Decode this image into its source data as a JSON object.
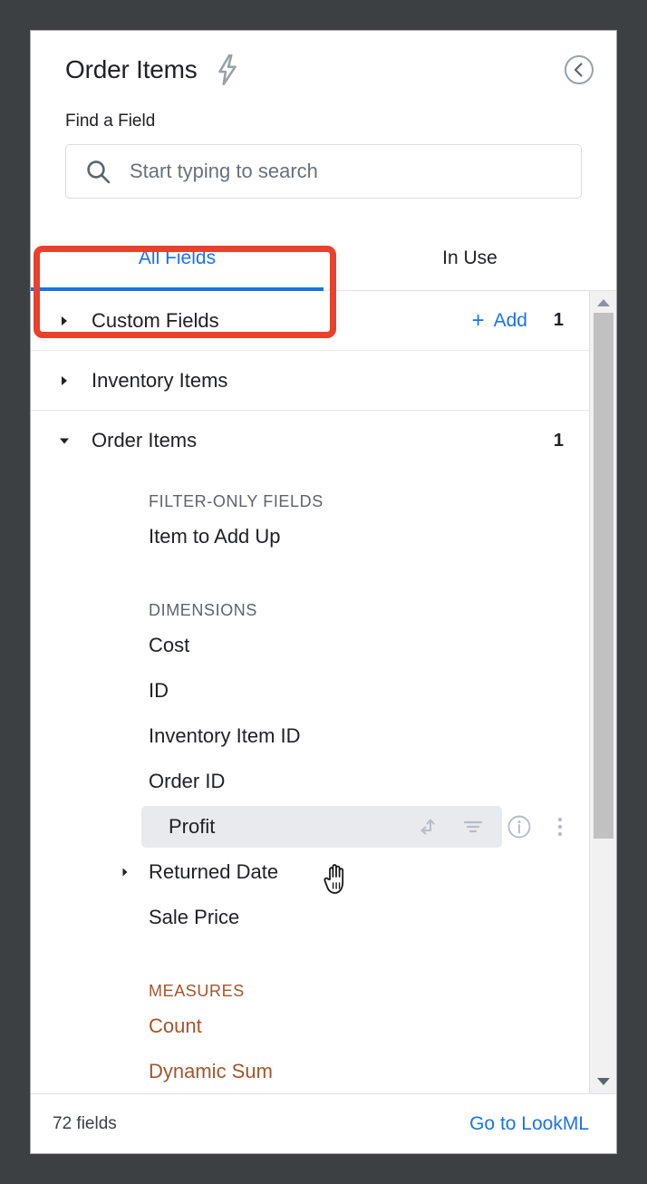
{
  "header": {
    "title": "Order Items",
    "bolt_icon": "lightning-bolt-icon",
    "collapse_icon": "chevron-left-circle-icon"
  },
  "search": {
    "label": "Find a Field",
    "placeholder": "Start typing to search",
    "value": "",
    "icon": "search-icon"
  },
  "tabs": [
    {
      "label": "All Fields",
      "active": true
    },
    {
      "label": "In Use",
      "active": false
    }
  ],
  "groups": [
    {
      "name": "Custom Fields",
      "expanded": false,
      "add_label": "Add",
      "add_plus": "+",
      "count": "1"
    },
    {
      "name": "Inventory Items",
      "expanded": false,
      "count": ""
    },
    {
      "name": "Order Items",
      "expanded": true,
      "count": "1"
    }
  ],
  "sections": [
    {
      "caption": "FILTER-ONLY FIELDS",
      "kind": "filter",
      "fields": [
        {
          "name": "Item to Add Up",
          "expandable": false
        }
      ]
    },
    {
      "caption": "DIMENSIONS",
      "kind": "dimension",
      "fields": [
        {
          "name": "Cost",
          "expandable": false
        },
        {
          "name": "ID",
          "expandable": false
        },
        {
          "name": "Inventory Item ID",
          "expandable": false
        },
        {
          "name": "Order ID",
          "expandable": false
        },
        {
          "name": "Profit",
          "expandable": false,
          "hovered": true
        },
        {
          "name": "Returned Date",
          "expandable": true
        },
        {
          "name": "Sale Price",
          "expandable": false
        }
      ]
    },
    {
      "caption": "MEASURES",
      "kind": "measure",
      "fields": [
        {
          "name": "Count",
          "expandable": false
        },
        {
          "name": "Dynamic Sum",
          "expandable": false,
          "clipped": true
        }
      ]
    }
  ],
  "row_actions": [
    {
      "name": "pivot-icon",
      "title": "Pivot"
    },
    {
      "name": "filter-icon",
      "title": "Filter"
    },
    {
      "name": "info-icon",
      "title": "Info"
    },
    {
      "name": "more-vert-icon",
      "title": "More"
    }
  ],
  "footer": {
    "field_count": "72 fields",
    "lookml_link": "Go to LookML"
  },
  "scrollbar": {
    "up_arrow": "scroll-up-arrow-icon",
    "down_arrow": "scroll-down-arrow-icon"
  },
  "annotation": {
    "target": "All Fields",
    "color": "#e8412c"
  },
  "colors": {
    "accent_blue": "#1a73e8",
    "measure_brown": "#a4552a",
    "text": "#202124",
    "muted": "#5f6368",
    "backdrop": "#3c4043",
    "hover_row": "#e8eaee"
  },
  "cursor": {
    "type": "pointer-hand"
  }
}
